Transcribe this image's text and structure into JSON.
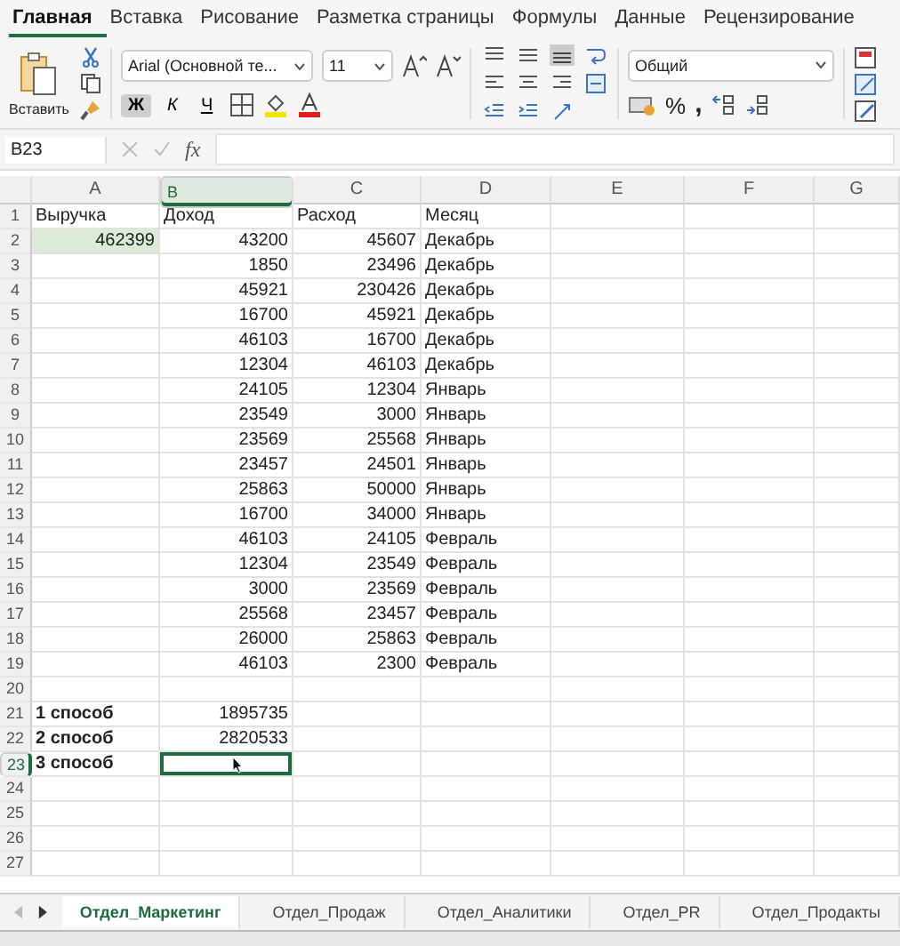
{
  "ribbon_tabs": [
    {
      "label": "Главная",
      "selected": true
    },
    {
      "label": "Вставка",
      "selected": false
    },
    {
      "label": "Рисование",
      "selected": false
    },
    {
      "label": "Разметка страницы",
      "selected": false
    },
    {
      "label": "Формулы",
      "selected": false
    },
    {
      "label": "Данные",
      "selected": false
    },
    {
      "label": "Рецензирование",
      "selected": false
    }
  ],
  "toolbar": {
    "paste_label": "Вставить",
    "font": {
      "value": "Arial (Основной те..."
    },
    "font_size": {
      "value": "11"
    },
    "style_buttons": [
      {
        "label": "Ж",
        "kind": "bold",
        "on": true
      },
      {
        "label": "К",
        "kind": "italic",
        "on": false
      },
      {
        "label": "Ч",
        "kind": "underline",
        "on": false
      }
    ],
    "number_format": {
      "value": "Общий"
    },
    "percent": "%",
    "comma": ","
  },
  "formula_bar": {
    "name_box": "B23",
    "fx": "fx"
  },
  "columns": [
    {
      "label": "A",
      "selected": false
    },
    {
      "label": "B",
      "selected": true
    },
    {
      "label": "C",
      "selected": false
    },
    {
      "label": "D",
      "selected": false
    },
    {
      "label": "E",
      "selected": false
    },
    {
      "label": "F",
      "selected": false
    },
    {
      "label": "G",
      "selected": false
    }
  ],
  "rows": [
    {
      "number": "1",
      "selected": false,
      "cells": [
        {
          "kind": "text",
          "value": "Выручка",
          "highlighted": false
        },
        {
          "kind": "text",
          "value": "Доход",
          "highlighted": false
        },
        {
          "kind": "text",
          "value": "Расход",
          "highlighted": false
        },
        {
          "kind": "text",
          "value": "Месяц",
          "highlighted": false
        }
      ]
    },
    {
      "number": "2",
      "selected": false,
      "cells": [
        {
          "kind": "number",
          "value": "462399",
          "highlighted": true
        },
        {
          "kind": "number",
          "value": "43200",
          "highlighted": false
        },
        {
          "kind": "number",
          "value": "45607",
          "highlighted": false
        },
        {
          "kind": "text",
          "value": "Декабрь",
          "highlighted": false
        }
      ]
    },
    {
      "number": "3",
      "selected": false,
      "cells": [
        null,
        {
          "kind": "number",
          "value": "1850",
          "highlighted": false
        },
        {
          "kind": "number",
          "value": "23496",
          "highlighted": false
        },
        {
          "kind": "text",
          "value": "Декабрь",
          "highlighted": false
        }
      ]
    },
    {
      "number": "4",
      "selected": false,
      "cells": [
        null,
        {
          "kind": "number",
          "value": "45921",
          "highlighted": false
        },
        {
          "kind": "number",
          "value": "230426",
          "highlighted": false
        },
        {
          "kind": "text",
          "value": "Декабрь",
          "highlighted": false
        }
      ]
    },
    {
      "number": "5",
      "selected": false,
      "cells": [
        null,
        {
          "kind": "number",
          "value": "16700",
          "highlighted": false
        },
        {
          "kind": "number",
          "value": "45921",
          "highlighted": false
        },
        {
          "kind": "text",
          "value": "Декабрь",
          "highlighted": false
        }
      ]
    },
    {
      "number": "6",
      "selected": false,
      "cells": [
        null,
        {
          "kind": "number",
          "value": "46103",
          "highlighted": false
        },
        {
          "kind": "number",
          "value": "16700",
          "highlighted": false
        },
        {
          "kind": "text",
          "value": "Декабрь",
          "highlighted": false
        }
      ]
    },
    {
      "number": "7",
      "selected": false,
      "cells": [
        null,
        {
          "kind": "number",
          "value": "12304",
          "highlighted": false
        },
        {
          "kind": "number",
          "value": "46103",
          "highlighted": false
        },
        {
          "kind": "text",
          "value": "Декабрь",
          "highlighted": false
        }
      ]
    },
    {
      "number": "8",
      "selected": false,
      "cells": [
        null,
        {
          "kind": "number",
          "value": "24105",
          "highlighted": false
        },
        {
          "kind": "number",
          "value": "12304",
          "highlighted": false
        },
        {
          "kind": "text",
          "value": "Январь",
          "highlighted": false
        }
      ]
    },
    {
      "number": "9",
      "selected": false,
      "cells": [
        null,
        {
          "kind": "number",
          "value": "23549",
          "highlighted": false
        },
        {
          "kind": "number",
          "value": "3000",
          "highlighted": false
        },
        {
          "kind": "text",
          "value": "Январь",
          "highlighted": false
        }
      ]
    },
    {
      "number": "10",
      "selected": false,
      "cells": [
        null,
        {
          "kind": "number",
          "value": "23569",
          "highlighted": false
        },
        {
          "kind": "number",
          "value": "25568",
          "highlighted": false
        },
        {
          "kind": "text",
          "value": "Январь",
          "highlighted": false
        }
      ]
    },
    {
      "number": "11",
      "selected": false,
      "cells": [
        null,
        {
          "kind": "number",
          "value": "23457",
          "highlighted": false
        },
        {
          "kind": "number",
          "value": "24501",
          "highlighted": false
        },
        {
          "kind": "text",
          "value": "Январь",
          "highlighted": false
        }
      ]
    },
    {
      "number": "12",
      "selected": false,
      "cells": [
        null,
        {
          "kind": "number",
          "value": "25863",
          "highlighted": false
        },
        {
          "kind": "number",
          "value": "50000",
          "highlighted": false
        },
        {
          "kind": "text",
          "value": "Январь",
          "highlighted": false
        }
      ]
    },
    {
      "number": "13",
      "selected": false,
      "cells": [
        null,
        {
          "kind": "number",
          "value": "16700",
          "highlighted": false
        },
        {
          "kind": "number",
          "value": "34000",
          "highlighted": false
        },
        {
          "kind": "text",
          "value": "Январь",
          "highlighted": false
        }
      ]
    },
    {
      "number": "14",
      "selected": false,
      "cells": [
        null,
        {
          "kind": "number",
          "value": "46103",
          "highlighted": false
        },
        {
          "kind": "number",
          "value": "24105",
          "highlighted": false
        },
        {
          "kind": "text",
          "value": "Февраль",
          "highlighted": false
        }
      ]
    },
    {
      "number": "15",
      "selected": false,
      "cells": [
        null,
        {
          "kind": "number",
          "value": "12304",
          "highlighted": false
        },
        {
          "kind": "number",
          "value": "23549",
          "highlighted": false
        },
        {
          "kind": "text",
          "value": "Февраль",
          "highlighted": false
        }
      ]
    },
    {
      "number": "16",
      "selected": false,
      "cells": [
        null,
        {
          "kind": "number",
          "value": "3000",
          "highlighted": false
        },
        {
          "kind": "number",
          "value": "23569",
          "highlighted": false
        },
        {
          "kind": "text",
          "value": "Февраль",
          "highlighted": false
        }
      ]
    },
    {
      "number": "17",
      "selected": false,
      "cells": [
        null,
        {
          "kind": "number",
          "value": "25568",
          "highlighted": false
        },
        {
          "kind": "number",
          "value": "23457",
          "highlighted": false
        },
        {
          "kind": "text",
          "value": "Февраль",
          "highlighted": false
        }
      ]
    },
    {
      "number": "18",
      "selected": false,
      "cells": [
        null,
        {
          "kind": "number",
          "value": "26000",
          "highlighted": false
        },
        {
          "kind": "number",
          "value": "25863",
          "highlighted": false
        },
        {
          "kind": "text",
          "value": "Февраль",
          "highlighted": false
        }
      ]
    },
    {
      "number": "19",
      "selected": false,
      "cells": [
        null,
        {
          "kind": "number",
          "value": "46103",
          "highlighted": false
        },
        {
          "kind": "number",
          "value": "2300",
          "highlighted": false
        },
        {
          "kind": "text",
          "value": "Февраль",
          "highlighted": false
        }
      ]
    },
    {
      "number": "20",
      "selected": false
    },
    {
      "number": "21",
      "selected": false,
      "cells": [
        {
          "kind": "label",
          "value": "1 способ",
          "highlighted": false
        },
        {
          "kind": "number",
          "value": "1895735",
          "highlighted": false
        }
      ]
    },
    {
      "number": "22",
      "selected": false,
      "cells": [
        {
          "kind": "label",
          "value": "2 способ",
          "highlighted": false
        },
        {
          "kind": "number",
          "value": "2820533",
          "highlighted": false
        }
      ]
    },
    {
      "number": "23",
      "selected": true,
      "cells": [
        {
          "kind": "label",
          "value": "3 способ",
          "highlighted": false
        }
      ]
    },
    {
      "number": "24",
      "selected": false
    },
    {
      "number": "25",
      "selected": false
    },
    {
      "number": "26",
      "selected": false
    },
    {
      "number": "27",
      "selected": false
    }
  ],
  "sheet_tabs": [
    {
      "label": "Отдел_Маркетинг",
      "selected": true
    },
    {
      "label": "Отдел_Продаж",
      "selected": false
    },
    {
      "label": "Отдел_Аналитики",
      "selected": false
    },
    {
      "label": "Отдел_PR",
      "selected": false
    },
    {
      "label": "Отдел_Продакты",
      "selected": false
    }
  ]
}
